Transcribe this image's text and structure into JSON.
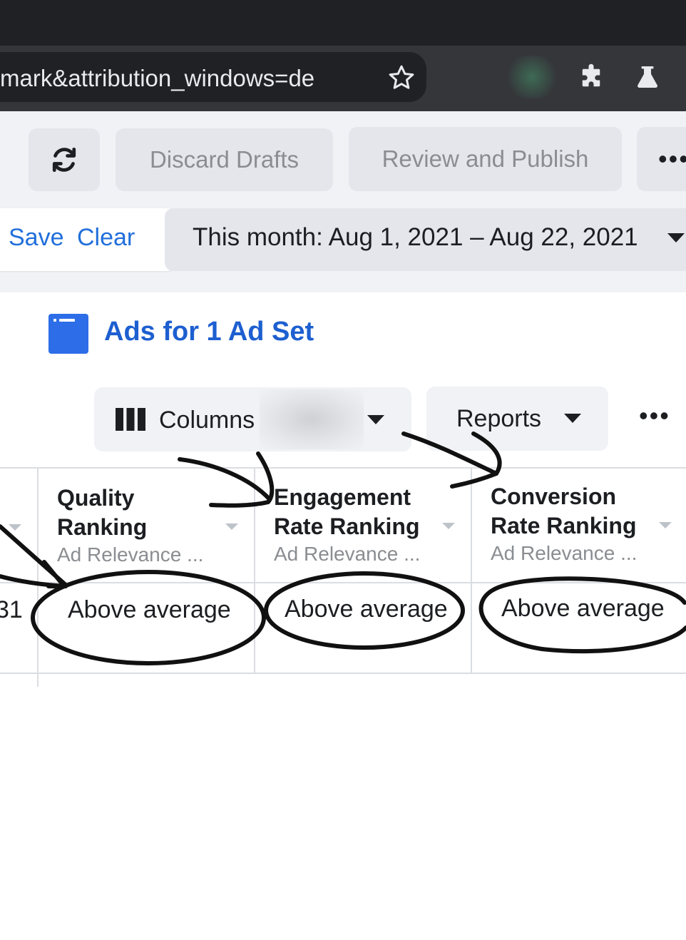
{
  "browser": {
    "url_fragment": "mark&attribution_windows=de",
    "icons": [
      "star-icon",
      "puzzle-icon",
      "flask-icon"
    ]
  },
  "toolbar": {
    "refresh_icon": "refresh-icon",
    "discard_label": "Discard Drafts",
    "review_label": "Review and Publish",
    "more_label": "•••"
  },
  "filters": {
    "save_label": "Save",
    "clear_label": "Clear",
    "date_range": "This month: Aug 1, 2021 – Aug 22, 2021"
  },
  "tab": {
    "title": "Ads for 1 Ad Set",
    "icon": "ad-icon"
  },
  "table_toolbar": {
    "columns_label": "Columns",
    "reports_label": "Reports",
    "more_label": "•••"
  },
  "table": {
    "columns": [
      {
        "title_line1": "Quality",
        "title_line2": "Ranking",
        "subtitle": "Ad Relevance ..."
      },
      {
        "title_line1": "Engagement",
        "title_line2": "Rate Ranking",
        "subtitle": "Ad Relevance ..."
      },
      {
        "title_line1": "Conversion",
        "title_line2": "Rate Ranking",
        "subtitle": "Ad Relevance ..."
      }
    ],
    "partial_cell": "31",
    "row": [
      "Above average",
      "Above average",
      "Above average"
    ]
  },
  "colors": {
    "chrome_dark": "#202124",
    "chrome_bar": "#35363a",
    "link_blue": "#216fdb",
    "title_blue": "#1d5fd0",
    "icon_blue": "#2d6ee8",
    "annotation_ink": "#111111"
  }
}
